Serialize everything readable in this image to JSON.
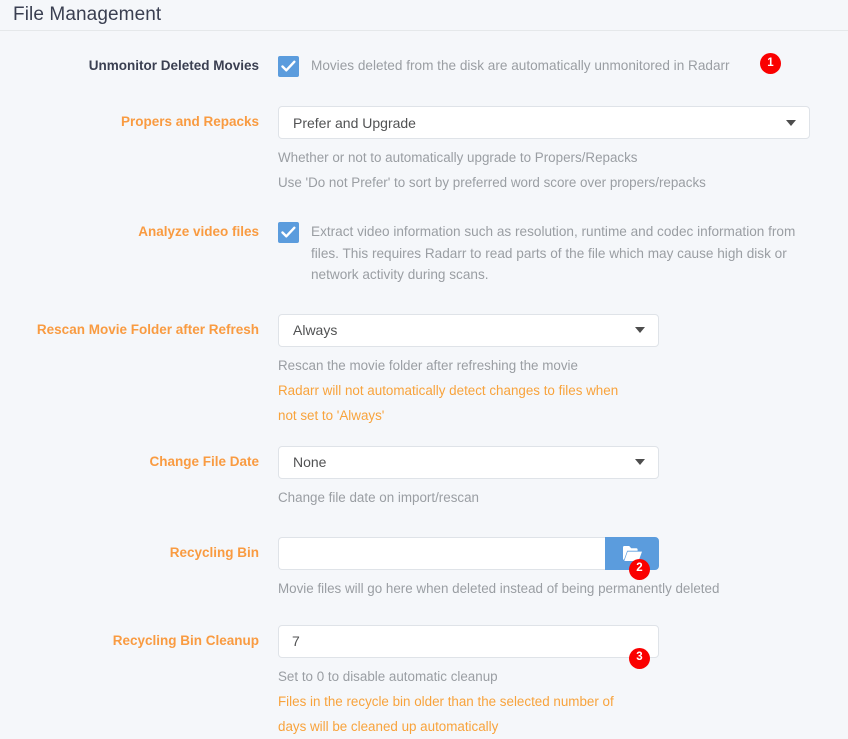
{
  "page": {
    "title": "File Management",
    "background": "#f5f7fa",
    "accent_orange": "#f99b41",
    "accent_blue": "#5b9cdd",
    "badge_red": "#fa0000"
  },
  "settings": [
    {
      "label": "Unmonitor Deleted Movies",
      "label_style": "dark",
      "type": "checkbox",
      "checked": true,
      "checkbox_text": "Movies deleted from the disk are automatically unmonitored in Radarr",
      "badge": "1"
    },
    {
      "label": "Propers and Repacks",
      "label_style": "orange",
      "type": "select",
      "value": "Prefer and Upgrade",
      "help": [
        "Whether or not to automatically upgrade to Propers/Repacks",
        "Use 'Do not Prefer' to sort by preferred word score over propers/repacks"
      ]
    },
    {
      "label": "Analyze video files",
      "label_style": "orange",
      "type": "checkbox",
      "checked": true,
      "checkbox_text": "Extract video information such as resolution, runtime and codec information from files. This requires Radarr to read parts of the file which may cause high disk or network activity during scans."
    },
    {
      "label": "Rescan Movie Folder after Refresh",
      "label_style": "orange",
      "type": "select",
      "value": "Always",
      "help": [
        "Rescan the movie folder after refreshing the movie"
      ],
      "warning": "Radarr will not automatically detect changes to files when not set to 'Always'"
    },
    {
      "label": "Change File Date",
      "label_style": "orange",
      "type": "select",
      "value": "None",
      "help": [
        "Change file date on import/rescan"
      ]
    },
    {
      "label": "Recycling Bin",
      "label_style": "orange",
      "type": "path",
      "value": "",
      "placeholder": "",
      "button_icon": "folder-open-icon",
      "help": [
        "Movie files will go here when deleted instead of being permanently deleted"
      ],
      "badge": "2"
    },
    {
      "label": "Recycling Bin Cleanup",
      "label_style": "orange",
      "type": "number",
      "value": "7",
      "help": [
        "Set to 0 to disable automatic cleanup"
      ],
      "warning": "Files in the recycle bin older than the selected number of days will be cleaned up automatically",
      "badge": "3"
    }
  ]
}
